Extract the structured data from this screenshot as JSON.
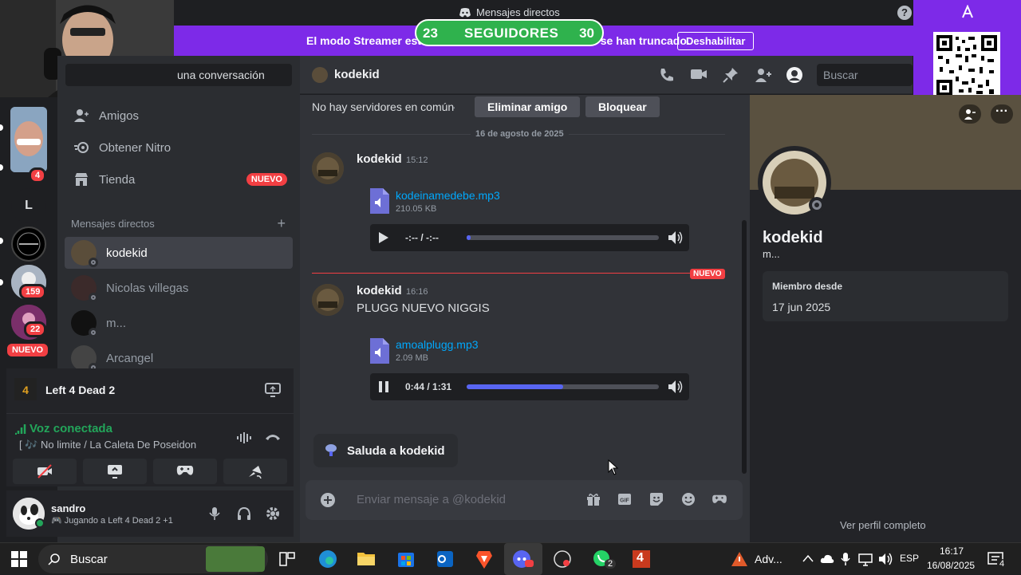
{
  "window": {
    "title": "Mensajes directos",
    "help": "?"
  },
  "streamer": {
    "message": "El modo Streamer está activado. Los datos del usuario se han truncado.",
    "button": "Deshabilitar"
  },
  "followers": {
    "left": "23",
    "label": "SEGUIDORES",
    "right": "30"
  },
  "servers": {
    "badge_top": "4",
    "letter": "L",
    "badge_159": "159",
    "badge_22": "22",
    "nuevo": "NUEVO"
  },
  "sidebar": {
    "find": "una conversación",
    "nav": [
      {
        "label": "Amigos"
      },
      {
        "label": "Obtener Nitro"
      },
      {
        "label": "Tienda",
        "tag": "NUEVO"
      }
    ],
    "dm_header": "Mensajes directos",
    "dms": [
      {
        "name": "kodekid",
        "active": true
      },
      {
        "name": "Nicolas villegas"
      },
      {
        "name": "m..."
      },
      {
        "name": "Arcangel"
      }
    ]
  },
  "activity": {
    "game": "Left 4 Dead 2"
  },
  "voice": {
    "status": "Voz conectada",
    "channel": "No limite / La Caleta De Poseidon"
  },
  "user": {
    "name": "sandro",
    "status": "Jugando a Left 4 Dead 2 +1"
  },
  "chat": {
    "header_name": "kodekid",
    "search_placeholder": "Buscar",
    "no_servers": "No hay servidores en común",
    "remove_friend": "Eliminar amigo",
    "block": "Bloquear",
    "date_divider": "16 de agosto de 2025",
    "new_tag": "NUEVO",
    "messages": [
      {
        "author": "kodekid",
        "time": "15:12",
        "file": "kodeinamedebe.mp3",
        "size": "210.05 KB",
        "player_time": "-:-- / -:--"
      },
      {
        "author": "kodekid",
        "time": "16:16",
        "text": "PLUGG NUEVO NIGGIS",
        "file": "amoalplugg.mp3",
        "size": "2.09 MB",
        "player_time": "0:44 / 1:31",
        "progress": 0.5
      }
    ],
    "wave": "Saluda a kodekid",
    "composer_placeholder": "Enviar mensaje a @kodekid"
  },
  "profile": {
    "name": "kodekid",
    "status": "m...",
    "member_since_label": "Miembro desde",
    "member_since": "17 jun 2025",
    "view_full": "Ver perfil completo"
  },
  "taskbar": {
    "search": "Buscar",
    "tray_app": "Adv...",
    "lang": "ESP",
    "time": "16:17",
    "date": "16/08/2025",
    "whatsapp_badge": "2",
    "notif_badge": "4",
    "l4d_badge": "4"
  },
  "colors": {
    "accent": "#5865f2",
    "streamer": "#7d2ae8",
    "danger": "#f23f43",
    "online": "#23a55a",
    "link": "#00a8fc"
  }
}
